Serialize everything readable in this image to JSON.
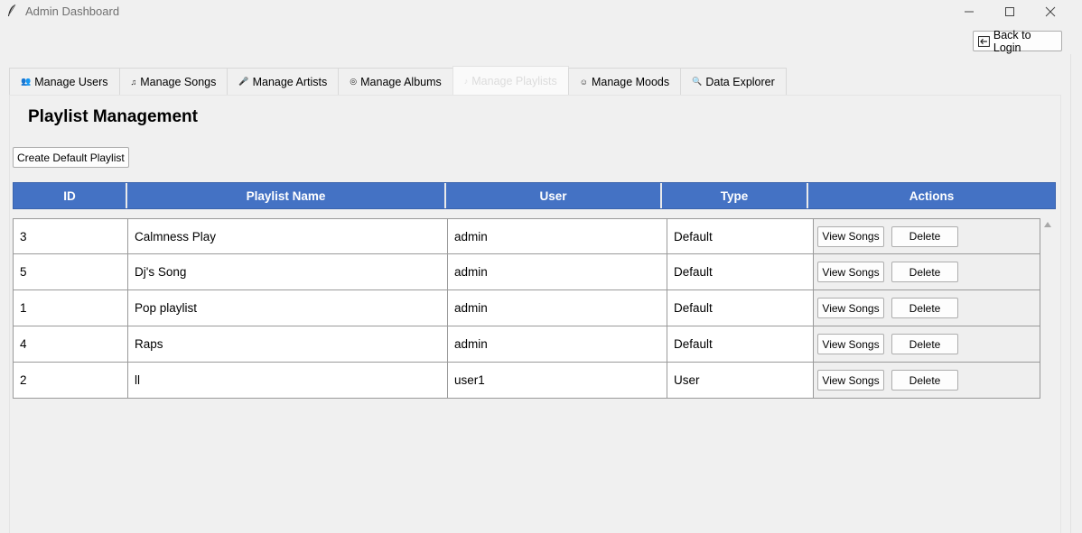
{
  "window": {
    "title": "Admin Dashboard"
  },
  "back_button": {
    "label": "Back to Login"
  },
  "tabs": [
    {
      "label": "Manage Users",
      "icon": "users-icon",
      "active": false
    },
    {
      "label": "Manage Songs",
      "icon": "music-note-icon",
      "active": false
    },
    {
      "label": "Manage Artists",
      "icon": "microphone-icon",
      "active": false
    },
    {
      "label": "Manage Albums",
      "icon": "disc-icon",
      "active": false
    },
    {
      "label": "Manage Playlists",
      "icon": "playlist-icon",
      "active": true
    },
    {
      "label": "Manage Moods",
      "icon": "smiley-icon",
      "active": false
    },
    {
      "label": "Data Explorer",
      "icon": "magnifier-icon",
      "active": false
    }
  ],
  "page": {
    "title": "Playlist Management",
    "create_button": "Create Default Playlist"
  },
  "table": {
    "columns": [
      "ID",
      "Playlist Name",
      "User",
      "Type",
      "Actions"
    ],
    "view_label": "View Songs",
    "delete_label": "Delete",
    "rows": [
      {
        "id": "3",
        "name": "Calmness Play",
        "user": "admin",
        "type": "Default"
      },
      {
        "id": "5",
        "name": "Dj's Song",
        "user": "admin",
        "type": "Default"
      },
      {
        "id": "1",
        "name": "Pop playlist",
        "user": "admin",
        "type": "Default"
      },
      {
        "id": "4",
        "name": "Raps",
        "user": "admin",
        "type": "Default"
      },
      {
        "id": "2",
        "name": "ll",
        "user": "user1",
        "type": "User"
      }
    ]
  },
  "colors": {
    "header_bg": "#4472c4",
    "header_text": "#ffffff",
    "window_bg": "#f0f0f0"
  }
}
